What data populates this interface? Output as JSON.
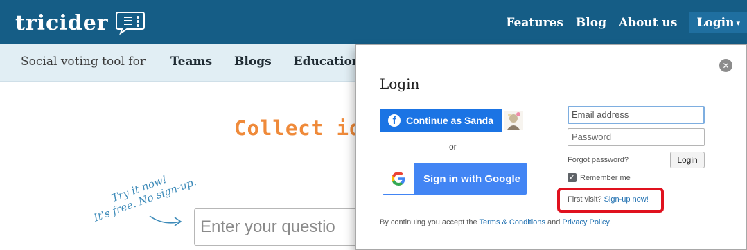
{
  "header": {
    "logo_text": "tricider",
    "nav": {
      "features": "Features",
      "blog": "Blog",
      "about": "About us",
      "login": "Login",
      "login_caret": "▾"
    }
  },
  "subnav": {
    "tagline": "Social voting tool for",
    "items": [
      "Teams",
      "Blogs",
      "Education"
    ]
  },
  "hero": {
    "heading": "Collect ide",
    "handwritten_line1": "Try it now!",
    "handwritten_line2": "It's free. No sign-up.",
    "question_placeholder": "Enter your questio"
  },
  "modal": {
    "close_symbol": "✕",
    "title": "Login",
    "facebook_button": "Continue as Sanda",
    "facebook_icon": "f",
    "or": "or",
    "google_button": "Sign in with Google",
    "email_placeholder": "Email address",
    "password_placeholder": "Password",
    "forgot": "Forgot password?",
    "login_button": "Login",
    "remember_check": "✓",
    "remember": "Remember me",
    "first_visit": "First visit?",
    "signup_link": "Sign-up now!",
    "terms_prefix": "By continuing you accept the",
    "terms_link": "Terms & Conditions",
    "terms_and": "and",
    "privacy_link": "Privacy Policy."
  },
  "colors": {
    "header_bg": "#155d86",
    "subnav_bg": "#e1eef4",
    "hero_accent": "#ef8a3a",
    "facebook_blue": "#1b74e4",
    "google_blue": "#4285f4",
    "highlight_red": "#e0111e",
    "link_blue": "#1e6fb0"
  },
  "icons": {
    "logo": "speech-bubble-logo-icon",
    "close": "close-circle-icon",
    "facebook": "facebook-icon",
    "google": "google-g-icon",
    "arrow": "curved-arrow-icon",
    "avatar": "user-avatar"
  }
}
